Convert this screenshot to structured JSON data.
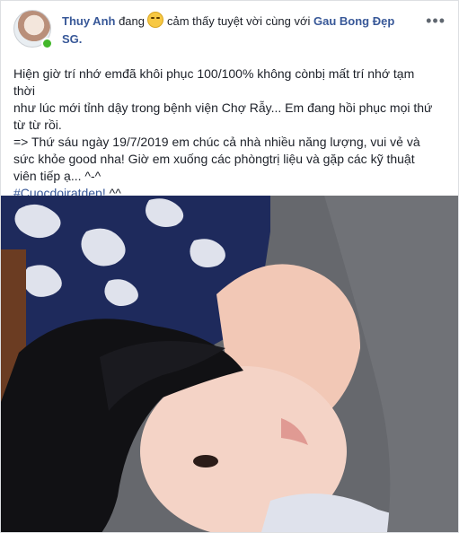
{
  "post": {
    "author": "Thuy Anh",
    "verb": "đang",
    "feeling_icon": "grinning-emoji",
    "feeling": "cảm thấy tuyệt vời cùng với",
    "tagged": "Gau Bong Đẹp",
    "tagged_line2": "SG.",
    "more_icon": "ellipsis-icon",
    "text_lines": [
      "Hiện giờ trí nhớ emđã khôi phục 100/100% không cònbị mất trí nhớ tạm thời",
      "như lúc mới tỉnh dậy trong bệnh viện Chợ Rẫy... Em đang hồi phục mọi thứ",
      "từ từ rồi.",
      "=> Thứ sáu ngày 19/7/2019 em chúc cả nhà nhiều năng lượng, vui vẻ và",
      "sức khỏe good nha! Giờ em xuống các phòngtrị liệu và gặp các kỹ thuật",
      "viên tiếp ạ... ^-^"
    ],
    "hashtag": "#Cuocdoiratdep!",
    "hashtag_suffix": " ^^"
  },
  "colors": {
    "link": "#385898",
    "text": "#1d2129",
    "online": "#42b72a"
  }
}
